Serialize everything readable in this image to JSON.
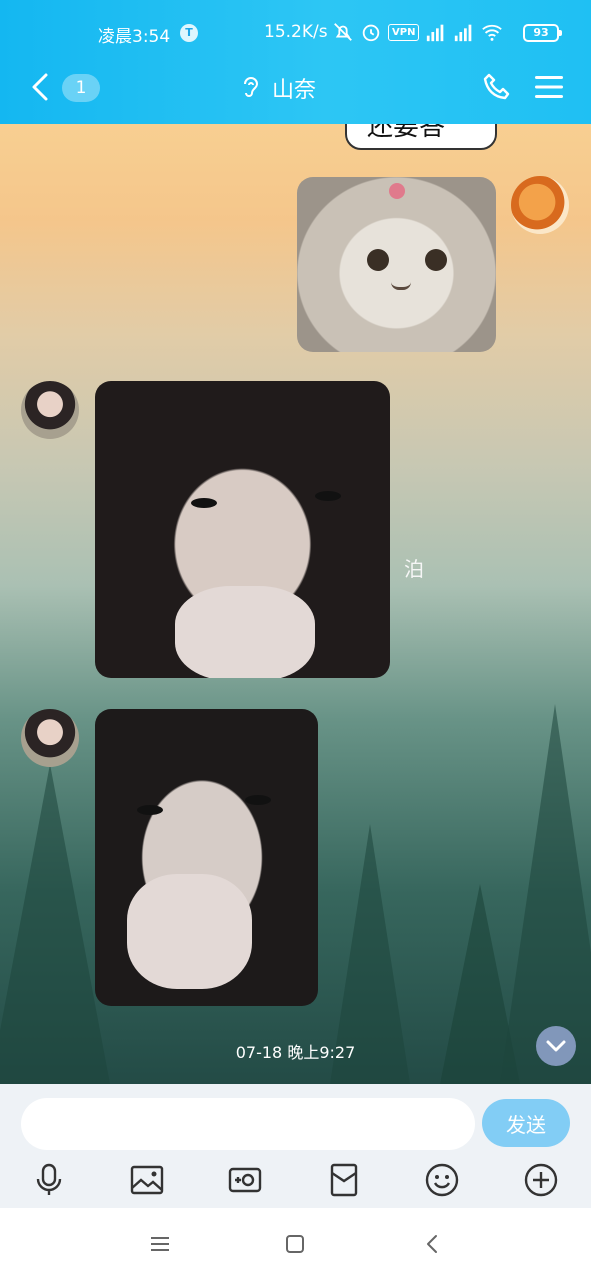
{
  "status_bar": {
    "time": "凌晨3:54",
    "t_badge": "T",
    "net_speed": "15.2K/s",
    "vpn": "VPN",
    "battery": "93"
  },
  "header": {
    "unread_count": "1",
    "contact_name": "山奈",
    "icons": [
      "back-icon",
      "ear-icon",
      "phone-icon",
      "menu-icon"
    ]
  },
  "chat": {
    "prev_bubble_text": "还要答",
    "side_char": "泊",
    "timestamp": "07-18 晚上9:27",
    "messages": [
      {
        "side": "right",
        "kind": "image",
        "subject": "cat"
      },
      {
        "side": "left",
        "kind": "image",
        "subject": "photo"
      },
      {
        "side": "left",
        "kind": "image",
        "subject": "photo"
      }
    ]
  },
  "composer": {
    "input_value": "",
    "send_label": "发送",
    "tools": [
      "microphone-icon",
      "image-icon",
      "camera-icon",
      "red-packet-icon",
      "emoji-icon",
      "plus-icon"
    ]
  },
  "colors": {
    "header_blue": "#1ebef3",
    "send_button": "#82cdf5"
  }
}
